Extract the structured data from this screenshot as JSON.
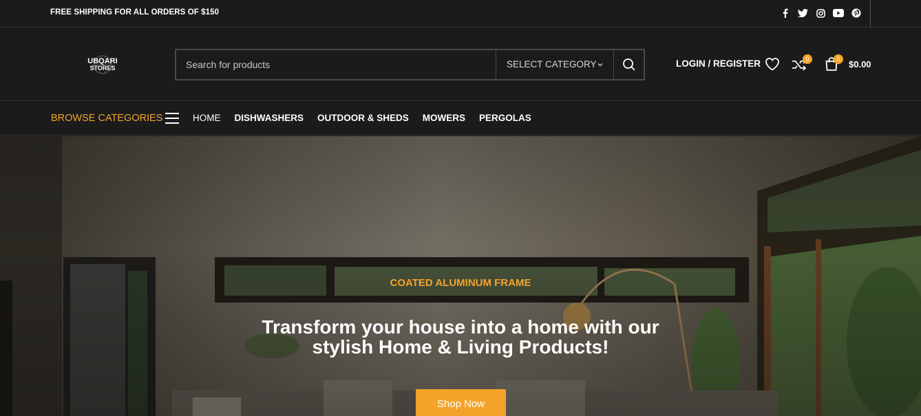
{
  "topbar": {
    "shipping_text": "FREE SHIPPING FOR ALL ORDERS OF $150",
    "social_icons": [
      "facebook-icon",
      "twitter-icon",
      "instagram-icon",
      "youtube-icon",
      "pinterest-icon"
    ]
  },
  "header": {
    "logo_line1": "UBQARI",
    "logo_line2": "STORES",
    "search_placeholder": "Search for products",
    "category_select": "SELECT CATEGORY",
    "login_label": "LOGIN / REGISTER",
    "compare_count": "0",
    "cart_count": "0",
    "cart_total": "$0.00"
  },
  "nav": {
    "browse_label": "BROWSE CATEGORIES",
    "items": [
      "HOME",
      "DISHWASHERS",
      "OUTDOOR & SHEDS",
      "MOWERS",
      "PERGOLAS"
    ]
  },
  "hero": {
    "subtitle": "COATED ALUMINUM FRAME",
    "title": "Transform your house into a home with our stylish Home & Living Products!",
    "button_label": "Shop Now"
  },
  "colors": {
    "accent": "#f3a32a",
    "background": "#1b1b1b"
  }
}
